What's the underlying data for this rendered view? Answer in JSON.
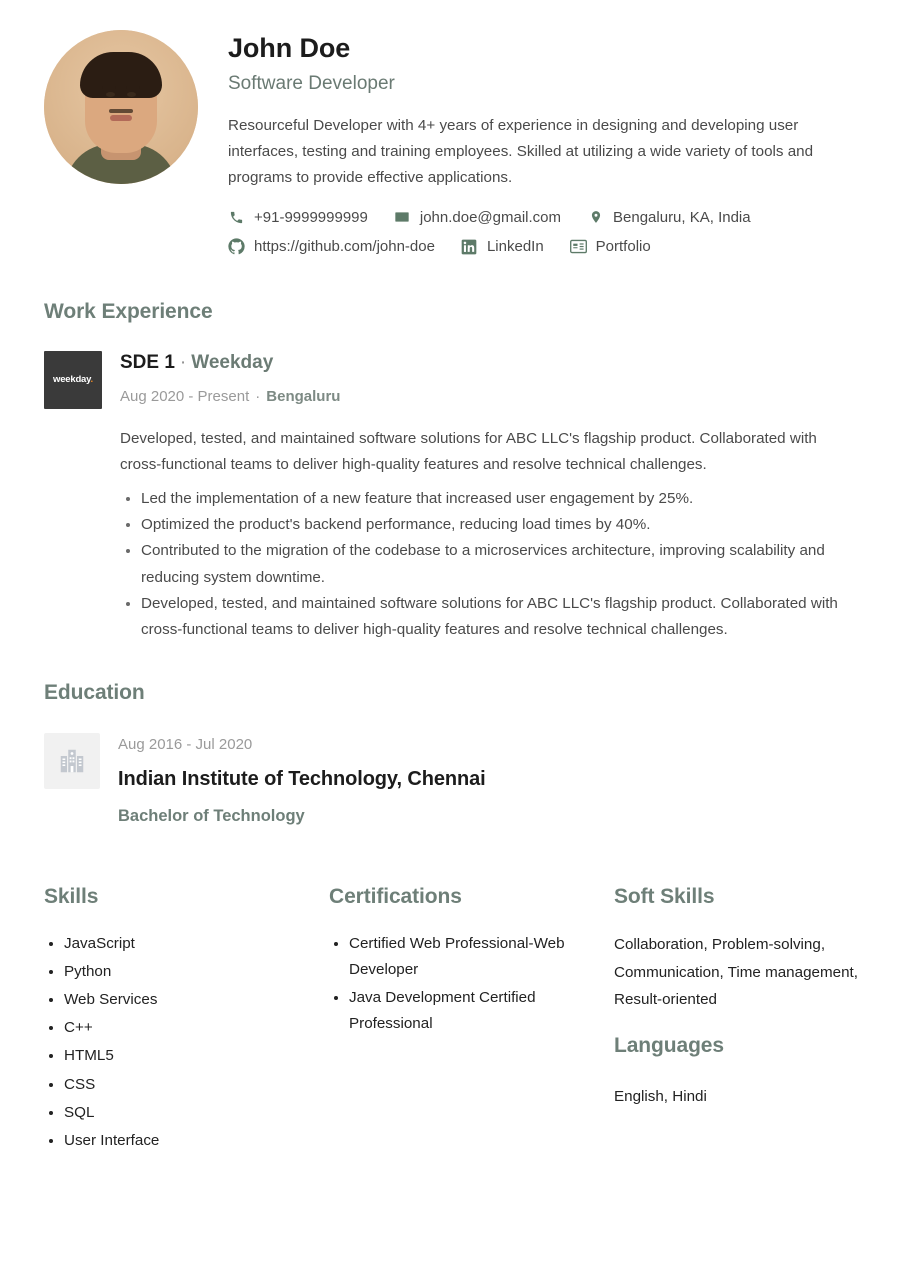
{
  "header": {
    "name": "John Doe",
    "title": "Software Developer",
    "summary": "Resourceful Developer with 4+ years of experience in designing and developing user interfaces, testing and training employees. Skilled at utilizing a wide variety of tools and programs to provide effective applications.",
    "avatar_alt": "profile-photo"
  },
  "contact": {
    "row1": [
      {
        "icon": "phone-icon",
        "text": "+91-9999999999"
      },
      {
        "icon": "email-icon",
        "text": "john.doe@gmail.com"
      },
      {
        "icon": "location-pin-icon",
        "text": "Bengaluru, KA, India"
      }
    ],
    "row2": [
      {
        "icon": "github-icon",
        "text": "https://github.com/john-doe"
      },
      {
        "icon": "linkedin-icon",
        "text": "LinkedIn"
      },
      {
        "icon": "portfolio-card-icon",
        "text": "Portfolio"
      }
    ]
  },
  "work": {
    "heading": "Work Experience",
    "entries": [
      {
        "logo_text": "weekday",
        "logo_dot": ".",
        "role": "SDE 1",
        "separator": "·",
        "company": "Weekday",
        "dates": "Aug 2020 - Present",
        "location": "Bengaluru",
        "description": "Developed, tested, and maintained software solutions for ABC LLC's flagship product. Collaborated with cross-functional teams to deliver high-quality features and resolve technical challenges.",
        "bullets": [
          "Led the implementation of a new feature that increased user engagement by 25%.",
          "Optimized the product's backend performance, reducing load times by 40%.",
          "Contributed to the migration of the codebase to a microservices architecture, improving scalability and reducing system downtime.",
          "Developed, tested, and maintained software solutions for ABC LLC's flagship product. Collaborated with cross-functional teams to deliver high-quality features and resolve technical challenges."
        ]
      }
    ]
  },
  "education": {
    "heading": "Education",
    "entries": [
      {
        "logo_icon": "building-icon",
        "dates": "Aug 2016 - Jul 2020",
        "school": "Indian Institute of Technology, Chennai",
        "degree": "Bachelor of Technology"
      }
    ]
  },
  "skills": {
    "heading": "Skills",
    "items": [
      "JavaScript",
      "Python",
      "Web Services",
      "C++",
      "HTML5",
      "CSS",
      "SQL",
      "User Interface"
    ]
  },
  "certifications": {
    "heading": "Certifications",
    "items": [
      "Certified Web Professional-Web Developer",
      "Java Development Certified Professional"
    ]
  },
  "soft_skills": {
    "heading": "Soft Skills",
    "text": "Collaboration, Problem-solving, Communication, Time management, Result-oriented"
  },
  "languages": {
    "heading": "Languages",
    "text": "English, Hindi"
  },
  "colors": {
    "heading_green": "#6e7f78",
    "icon_green": "#5d7a68",
    "body_text": "#4a4a4a",
    "name_black": "#1c1c1c",
    "muted_gray": "#9a9a9a",
    "logo_dark": "#3a3a3a",
    "logo_accent_orange": "#f08a24",
    "page_background": "#ffffff"
  }
}
